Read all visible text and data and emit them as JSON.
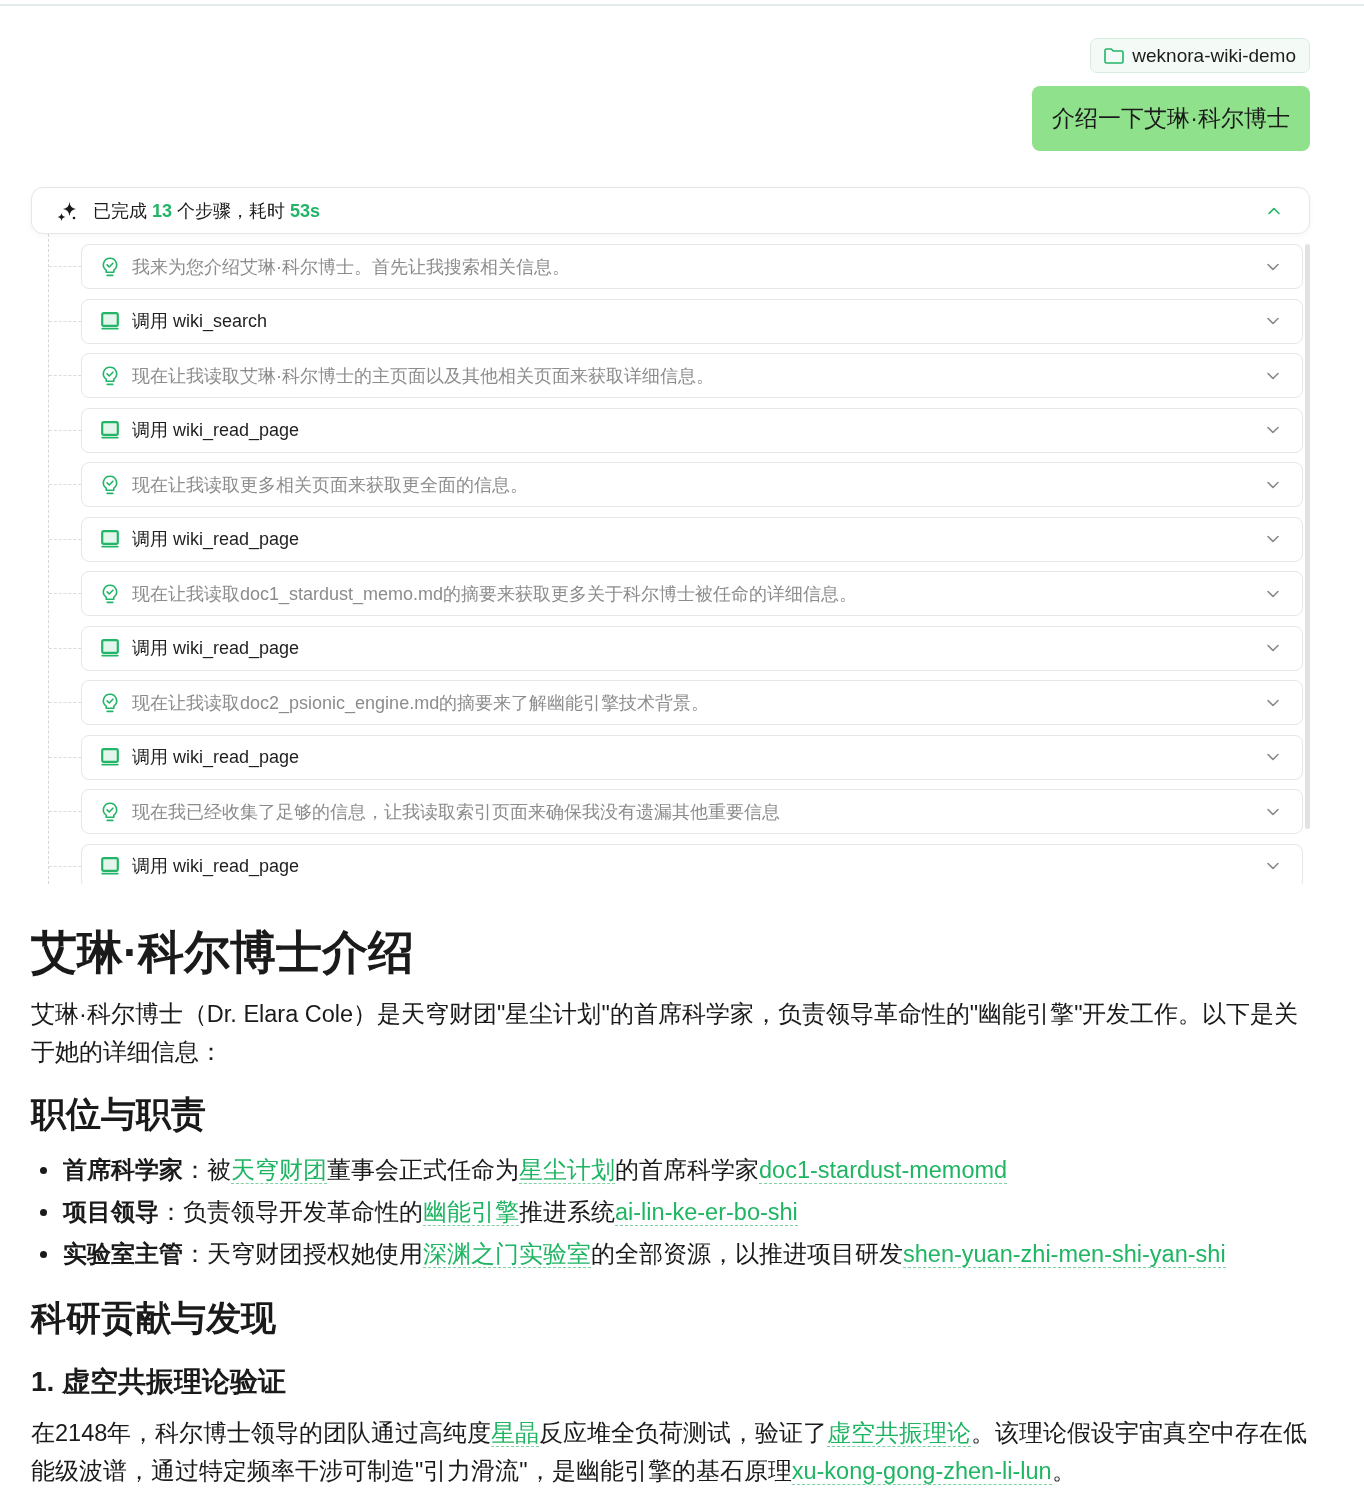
{
  "workspace_chip": {
    "label": "weknora-wiki-demo"
  },
  "user_message": {
    "text": "介绍一下艾琳·科尔博士"
  },
  "agent_steps": {
    "expanded": true,
    "summary": [
      {
        "kind": "plain",
        "text": "已完成 "
      },
      {
        "kind": "metric",
        "text": "13"
      },
      {
        "kind": "plain",
        "text": " 个步骤，耗时 "
      },
      {
        "kind": "metric",
        "text": "53s"
      }
    ],
    "steps": [
      {
        "kind": "thought",
        "text": "我来为您介绍艾琳·科尔博士。首先让我搜索相关信息。",
        "expanded": false
      },
      {
        "kind": "tool",
        "text": "调用 wiki_search",
        "expanded": false
      },
      {
        "kind": "thought",
        "text": "现在让我读取艾琳·科尔博士的主页面以及其他相关页面来获取详细信息。",
        "expanded": false
      },
      {
        "kind": "tool",
        "text": "调用 wiki_read_page",
        "expanded": false
      },
      {
        "kind": "thought",
        "text": "现在让我读取更多相关页面来获取更全面的信息。",
        "expanded": false
      },
      {
        "kind": "tool",
        "text": "调用 wiki_read_page",
        "expanded": false
      },
      {
        "kind": "thought",
        "text": "现在让我读取doc1_stardust_memo.md的摘要来获取更多关于科尔博士被任命的详细信息。",
        "expanded": false
      },
      {
        "kind": "tool",
        "text": "调用 wiki_read_page",
        "expanded": false
      },
      {
        "kind": "thought",
        "text": "现在让我读取doc2_psionic_engine.md的摘要来了解幽能引擎技术背景。",
        "expanded": false
      },
      {
        "kind": "tool",
        "text": "调用 wiki_read_page",
        "expanded": false
      },
      {
        "kind": "thought",
        "text": "现在我已经收集了足够的信息，让我读取索引页面来确保我没有遗漏其他重要信息",
        "expanded": false
      },
      {
        "kind": "tool",
        "text": "调用 wiki_read_page",
        "expanded": false
      }
    ]
  },
  "answer": {
    "blocks": [
      {
        "kind": "h1",
        "text": "艾琳·科尔博士介绍"
      },
      {
        "kind": "paragraph",
        "segments": [
          {
            "kind": "text",
            "text": "艾琳·科尔博士（Dr. Elara Cole）是天穹财团\"星尘计划\"的首席科学家，负责领导革命性的\"幽能引擎\"开发工作。以下是关于她的详细信息："
          }
        ]
      },
      {
        "kind": "h2",
        "text": "职位与职责"
      },
      {
        "kind": "bullets",
        "items": [
          {
            "segments": [
              {
                "kind": "bold",
                "text": "首席科学家"
              },
              {
                "kind": "text",
                "text": "：被"
              },
              {
                "kind": "link",
                "text": "天穹财团"
              },
              {
                "kind": "text",
                "text": "董事会正式任命为"
              },
              {
                "kind": "link",
                "text": "星尘计划"
              },
              {
                "kind": "text",
                "text": "的首席科学家"
              },
              {
                "kind": "link",
                "text": "doc1-stardust-memomd"
              }
            ]
          },
          {
            "segments": [
              {
                "kind": "bold",
                "text": "项目领导"
              },
              {
                "kind": "text",
                "text": "：负责领导开发革命性的"
              },
              {
                "kind": "link",
                "text": "幽能引擎"
              },
              {
                "kind": "text",
                "text": "推进系统"
              },
              {
                "kind": "link",
                "text": "ai-lin-ke-er-bo-shi"
              }
            ]
          },
          {
            "segments": [
              {
                "kind": "bold",
                "text": "实验室主管"
              },
              {
                "kind": "text",
                "text": "：天穹财团授权她使用"
              },
              {
                "kind": "link",
                "text": "深渊之门实验室"
              },
              {
                "kind": "text",
                "text": "的全部资源，以推进项目研发"
              },
              {
                "kind": "link",
                "text": "shen-yuan-zhi-men-shi-yan-shi"
              }
            ]
          }
        ]
      },
      {
        "kind": "h2",
        "text": "科研贡献与发现"
      },
      {
        "kind": "h3",
        "text": "1. 虚空共振理论验证"
      },
      {
        "kind": "paragraph",
        "segments": [
          {
            "kind": "text",
            "text": "在2148年，科尔博士领导的团队通过高纯度"
          },
          {
            "kind": "link",
            "text": "星晶"
          },
          {
            "kind": "text",
            "text": "反应堆全负荷测试，验证了"
          },
          {
            "kind": "link",
            "text": "虚空共振理论"
          },
          {
            "kind": "text",
            "text": "。该理论假设宇宙真空中存在低能级波谱，通过特定频率干涉可制造\"引力滑流\"，是幽能引擎的基石原理"
          },
          {
            "kind": "link",
            "text": "xu-kong-gong-zhen-li-lun"
          },
          {
            "kind": "text",
            "text": "。"
          }
        ]
      }
    ]
  }
}
